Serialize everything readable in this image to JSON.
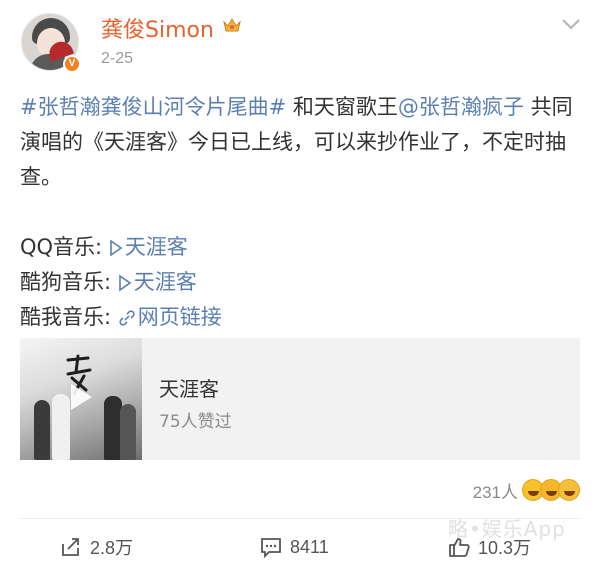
{
  "header": {
    "username": "龚俊Simon",
    "time": "2-25",
    "verified_badge": "V"
  },
  "post": {
    "line1_hashtag": "#张哲瀚龚俊山河令片尾曲#",
    "line1_text": " 和天窗歌王",
    "line1_mention": "@张哲瀚疯子",
    "line1_rest": " 共同演唱的《天涯客》今日已上线，可以来抄作业了，不定时抽查。",
    "links": [
      {
        "label": "QQ音乐: ",
        "link_text": "天涯客",
        "icon": "play-icon"
      },
      {
        "label": "酷狗音乐: ",
        "link_text": "天涯客",
        "icon": "play-icon"
      },
      {
        "label": "酷我音乐: ",
        "link_text": "网页链接",
        "icon": "link-icon"
      }
    ]
  },
  "card": {
    "title": "天涯客",
    "subtitle": "75人赞过",
    "thumb_text": "天涯"
  },
  "reactions": {
    "count": "231人"
  },
  "actions": {
    "repost": "2.8万",
    "comment": "8411",
    "like": "10.3万"
  },
  "watermark": "略•娱乐App",
  "colors": {
    "username": "#e8622d",
    "link": "#5b7fb3",
    "badge": "#f58220"
  }
}
